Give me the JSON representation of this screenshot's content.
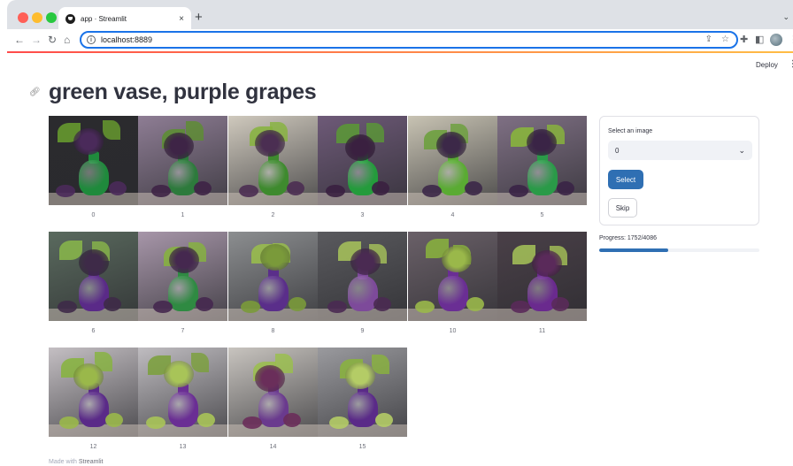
{
  "browser": {
    "tab_title": "app · Streamlit",
    "tab_close": "×",
    "new_tab": "+",
    "url": "localhost:8889",
    "traffic_colors": [
      "#ff5f57",
      "#febc2e",
      "#28c840"
    ]
  },
  "app": {
    "deploy_label": "Deploy",
    "menu_glyph": "⋮",
    "title": "green vase, purple grapes",
    "images": [
      {
        "caption": "0",
        "bg": "#2b2b2e",
        "vase": "#1f8a3c",
        "grape": "#4a2a5a",
        "leaf": "#6aa02e"
      },
      {
        "caption": "1",
        "bg": "#8e7d94",
        "vase": "#2d7a3c",
        "grape": "#3e2446",
        "leaf": "#5c8f30"
      },
      {
        "caption": "2",
        "bg": "#cfc9bd",
        "vase": "#3e8a2e",
        "grape": "#4b2e52",
        "leaf": "#86b43c"
      },
      {
        "caption": "3",
        "bg": "#6e5a78",
        "vase": "#249b3c",
        "grape": "#3a2040",
        "leaf": "#5a9a35"
      },
      {
        "caption": "4",
        "bg": "#c8c3b3",
        "vase": "#5aab33",
        "grape": "#3c2848",
        "leaf": "#6aa03a"
      },
      {
        "caption": "5",
        "bg": "#7f7084",
        "vase": "#2a9a48",
        "grape": "#3a2446",
        "leaf": "#8ab83a"
      },
      {
        "caption": "6",
        "bg": "#5a6a5e",
        "vase": "#5a2a88",
        "grape": "#3e2a48",
        "leaf": "#8ab84a"
      },
      {
        "caption": "7",
        "bg": "#a796a9",
        "vase": "#2f8a42",
        "grape": "#45284f",
        "leaf": "#86b43c"
      },
      {
        "caption": "8",
        "bg": "#8c8e90",
        "vase": "#5a2e8a",
        "grape": "#7a9a3a",
        "leaf": "#9ac04a"
      },
      {
        "caption": "9",
        "bg": "#5a5a5e",
        "vase": "#7d4a9a",
        "grape": "#4a2a52",
        "leaf": "#a8c45a"
      },
      {
        "caption": "10",
        "bg": "#6a6068",
        "vase": "#6a2e94",
        "grape": "#9ab84a",
        "leaf": "#8ab43c"
      },
      {
        "caption": "11",
        "bg": "#4a4048",
        "vase": "#6a2a8e",
        "grape": "#5a2a5a",
        "leaf": "#a6c458"
      },
      {
        "caption": "12",
        "bg": "#c4bfc3",
        "vase": "#5a2a88",
        "grape": "#9ab84a",
        "leaf": "#86b43c"
      },
      {
        "caption": "13",
        "bg": "#bfbcc0",
        "vase": "#6a2e94",
        "grape": "#a8c458",
        "leaf": "#7aa03a"
      },
      {
        "caption": "14",
        "bg": "#c8c4bf",
        "vase": "#6a3a8e",
        "grape": "#6a2e5a",
        "leaf": "#9ac04a"
      },
      {
        "caption": "15",
        "bg": "#9a9a9e",
        "vase": "#5a2a88",
        "grape": "#b4cc66",
        "leaf": "#8ab43c"
      }
    ],
    "panel": {
      "select_label": "Select an image",
      "select_value": "0",
      "select_button": "Select",
      "skip_button": "Skip"
    },
    "progress": {
      "label": "Progress: 1752/4086",
      "value": 0.4288
    },
    "footer_prefix": "Made with",
    "footer_brand": "Streamlit"
  }
}
